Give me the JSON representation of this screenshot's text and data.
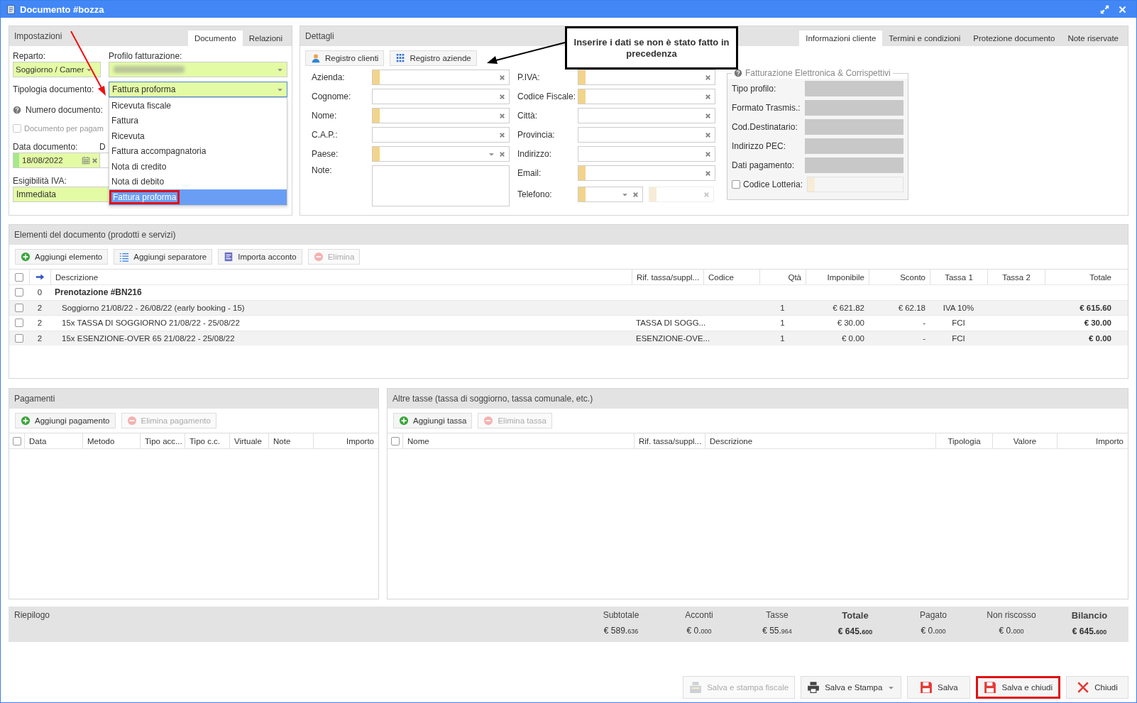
{
  "window": {
    "title": "Documento #bozza"
  },
  "annotation": {
    "callout": "Inserire i dati se non è stato fatto in precedenza"
  },
  "settings": {
    "title": "Impostazioni",
    "tabs": [
      {
        "label": "Documento",
        "selected": true
      },
      {
        "label": "Relazioni",
        "selected": false
      }
    ],
    "reparto": {
      "label": "Reparto:",
      "value": "Soggiorno / Camer"
    },
    "profilo": {
      "label": "Profilo fatturazione:"
    },
    "tipologia": {
      "label": "Tipologia documento:",
      "value": "Fattura proforma",
      "expanded": true,
      "options": [
        {
          "label": "Ricevuta fiscale",
          "selected": false,
          "highlighted": false
        },
        {
          "label": "Fattura",
          "selected": false,
          "highlighted": false
        },
        {
          "label": "Ricevuta",
          "selected": false,
          "highlighted": false
        },
        {
          "label": "Fattura accompagnatoria",
          "selected": false,
          "highlighted": false
        },
        {
          "label": "Nota di credito",
          "selected": false,
          "highlighted": false
        },
        {
          "label": "Nota di debito",
          "selected": false,
          "highlighted": false
        },
        {
          "label": "Fattura proforma",
          "selected": true,
          "highlighted": true
        }
      ]
    },
    "numero": {
      "label": "Numero documento:"
    },
    "pagamento": {
      "label": "Documento per pagam",
      "checked": false,
      "disabled": true
    },
    "data": {
      "label": "Data documento:",
      "value": "18/08/2022"
    },
    "column_2_label": "D",
    "esigibilita": {
      "label": "Esigibilità IVA:",
      "value": "Immediata"
    }
  },
  "details": {
    "title": "Dettagli",
    "tabs": [
      {
        "label": "Informazioni cliente",
        "selected": true
      },
      {
        "label": "Termini e condizioni",
        "selected": false
      },
      {
        "label": "Protezione documento",
        "selected": false
      },
      {
        "label": "Note riservate",
        "selected": false
      }
    ],
    "buttons": [
      {
        "label": "Registro clienti"
      },
      {
        "label": "Registro aziende"
      }
    ],
    "fields_left": [
      {
        "label": "Azienda:",
        "kind": "text",
        "required": true
      },
      {
        "label": "Cognome:",
        "kind": "text",
        "required": false
      },
      {
        "label": "Nome:",
        "kind": "text",
        "required": true
      },
      {
        "label": "C.A.P.:",
        "kind": "text",
        "required": false
      },
      {
        "label": "Paese:",
        "kind": "select",
        "required": true
      },
      {
        "label": "Note:",
        "kind": "textarea",
        "required": false
      }
    ],
    "fields_right": [
      {
        "label": "P.IVA:",
        "kind": "text",
        "required": true
      },
      {
        "label": "Codice Fiscale:",
        "kind": "text",
        "required": true
      },
      {
        "label": "Città:",
        "kind": "text",
        "required": false
      },
      {
        "label": "Provincia:",
        "kind": "text",
        "required": false
      },
      {
        "label": "Indirizzo:",
        "kind": "text",
        "required": false
      },
      {
        "label": "Email:",
        "kind": "text",
        "required": true
      },
      {
        "label": "Telefono:",
        "kind": "phone",
        "required": true
      }
    ],
    "einvoice": {
      "title": "Fatturazione Elettronica & Corrispettivi",
      "fields": [
        {
          "label": "Tipo profilo:"
        },
        {
          "label": "Formato Trasmis.:"
        },
        {
          "label": "Cod.Destinatario:"
        },
        {
          "label": "Indirizzo PEC:"
        },
        {
          "label": "Dati pagamento:"
        }
      ],
      "lottery": {
        "label": "Codice Lotteria:",
        "checked": false
      }
    }
  },
  "items": {
    "title": "Elementi del documento (prodotti e servizi)",
    "toolbar": [
      {
        "label": "Aggiungi elemento",
        "disabled": false
      },
      {
        "label": "Aggiungi separatore",
        "disabled": false
      },
      {
        "label": "Importa acconto",
        "disabled": false
      },
      {
        "label": "Elimina",
        "disabled": true
      }
    ],
    "select_all": {
      "checked": false
    },
    "columns": [
      "Descrizione",
      "Rif. tassa/suppl...",
      "Codice",
      "Qtà",
      "Imponibile",
      "Sconto",
      "Tassa 1",
      "Tassa 2",
      "Totale"
    ],
    "rows": [
      {
        "kind": "group",
        "checked": false,
        "column_2": "0",
        "descrizione": "Prenotazione #BN216"
      },
      {
        "kind": "item",
        "checked": false,
        "column_2": "2",
        "descrizione": "Soggiorno 21/08/22 - 26/08/22 (early booking - 15)",
        "qta": "1",
        "imponibile": "€ 621.82",
        "sconto": "€ 62.18",
        "tassa_1": "IVA 10%",
        "totale": "€ 615.60"
      },
      {
        "kind": "item",
        "checked": false,
        "column_2": "2",
        "descrizione": "15x TASSA DI SOGGIORNO 21/08/22 - 25/08/22",
        "rif": "TASSA DI SOGG...",
        "qta": "1",
        "imponibile": "€ 30.00",
        "sconto": "-",
        "tassa_1": "FCI",
        "totale": "€ 30.00"
      },
      {
        "kind": "item",
        "checked": false,
        "column_2": "2",
        "descrizione": "15x ESENZIONE-OVER 65 21/08/22 - 25/08/22",
        "rif": "ESENZIONE-OVE...",
        "qta": "1",
        "imponibile": "€ 0.00",
        "sconto": "-",
        "tassa_1": "FCI",
        "totale": "€ 0.00"
      }
    ]
  },
  "payments": {
    "title": "Pagamenti",
    "toolbar": [
      {
        "label": "Aggiungi pagamento",
        "disabled": false
      },
      {
        "label": "Elimina pagamento",
        "disabled": true
      }
    ],
    "select_all": {
      "checked": false
    },
    "columns": [
      "Data",
      "Metodo",
      "Tipo acc...",
      "Tipo c.c.",
      "Virtuale",
      "Note",
      "Importo"
    ]
  },
  "taxes": {
    "title": "Altre tasse (tassa di soggiorno, tassa comunale, etc.)",
    "toolbar": [
      {
        "label": "Aggiungi tassa",
        "disabled": false
      },
      {
        "label": "Elimina tassa",
        "disabled": true
      }
    ],
    "select_all": {
      "checked": false
    },
    "columns": [
      "Nome",
      "Rif. tassa/suppl...",
      "Descrizione",
      "Tipologia",
      "Valore",
      "Importo"
    ]
  },
  "summary": {
    "title": "Riepilogo",
    "items": [
      {
        "label": "Subtotale",
        "value": "€ 589.$_{636}$",
        "bold": false
      },
      {
        "label": "Acconti",
        "value": "€ 0.$_{000}$",
        "bold": false
      },
      {
        "label": "Tasse",
        "value": "€ 55.$_{964}$",
        "bold": false
      },
      {
        "label": "Totale",
        "value": "€ 645.$_{600}$",
        "bold": true
      },
      {
        "label": "Pagato",
        "value": "€ 0.$_{000}$",
        "bold": false
      },
      {
        "label": "Non riscosso",
        "value": "€ 0.$_{000}$",
        "bold": false
      },
      {
        "label": "Bilancio",
        "value": "€ 645.$_{600}$",
        "bold": true
      }
    ]
  },
  "footer": [
    {
      "label": "Salva e stampa fiscale",
      "disabled": true,
      "highlighted": false,
      "menu": false
    },
    {
      "label": "Salva e Stampa",
      "disabled": false,
      "highlighted": false,
      "menu": true
    },
    {
      "label": "Salva",
      "disabled": false,
      "highlighted": false,
      "menu": false
    },
    {
      "label": "Salva e chiudi",
      "disabled": false,
      "highlighted": true,
      "menu": false
    },
    {
      "label": "Chiudi",
      "disabled": false,
      "highlighted": false,
      "menu": false
    }
  ]
}
